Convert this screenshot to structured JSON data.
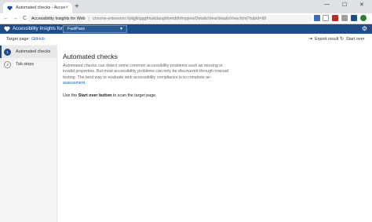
{
  "browser": {
    "tab_title": "Automated checks - Accessibilit",
    "tab_close": "×",
    "new_tab": "+",
    "window_controls": [
      "—",
      "☐",
      "✕"
    ],
    "address_site": "Accessibility Insights for Web",
    "address_url": "chrome-extension://pbjjkligggfmakdaogkfomddhfmpjeni/DetailsView/detailsView.html?tabId=98",
    "nav": {
      "back": "←",
      "forward": "→",
      "reload": "C"
    }
  },
  "app": {
    "title": "Accessibility Insights for Web",
    "mode": "FastPass",
    "colors": {
      "header": "#1e4d8a",
      "link": "#1a5fb4"
    }
  },
  "command_bar": {
    "target_label": "Target page:",
    "target_link": "GitHub",
    "export_label": "Export result",
    "start_over_label": "Start over"
  },
  "left_nav": {
    "items": [
      {
        "number": "1",
        "label": "Automated checks",
        "active": true
      },
      {
        "number": "2",
        "label": "Tab stops",
        "active": false
      }
    ]
  },
  "main": {
    "title": "Automated checks",
    "description_text": "Automated checks can detect some common accessibility problems such as missing or invalid properties. But most accessibility problems can only be discovered through manual testing. The best way to evaluate web accessibility compliance is to complete an",
    "description_link": "assessment",
    "description_end": ".",
    "instruction_prefix": "Use the",
    "instruction_bold": "Start over button",
    "instruction_suffix": "to scan the target page."
  }
}
